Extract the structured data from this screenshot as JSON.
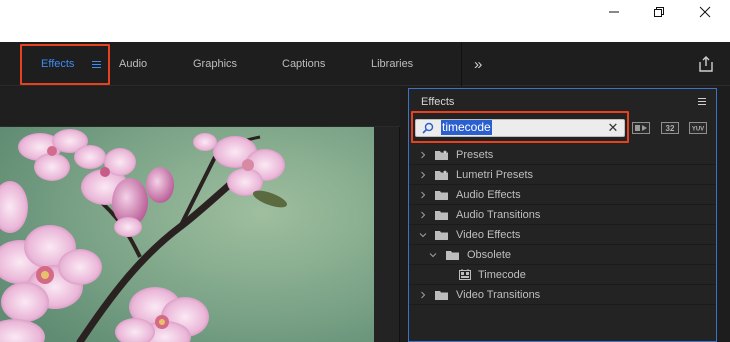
{
  "window": {
    "minimize_icon": "minimize-icon",
    "maximize_icon": "restore-icon",
    "close_icon": "close-icon"
  },
  "workspaces": {
    "tabs": [
      {
        "label": "Effects",
        "active": true
      },
      {
        "label": "Audio"
      },
      {
        "label": "Graphics"
      },
      {
        "label": "Captions"
      },
      {
        "label": "Libraries"
      }
    ],
    "overflow_label": "»",
    "accent": "#3d8bf5",
    "highlight": "#e8411f"
  },
  "effects_panel": {
    "title": "Effects",
    "search": {
      "value": "timecode",
      "clear_label": "✕"
    },
    "buttons": [
      {
        "name": "accelerated-effects-icon"
      },
      {
        "name": "32-bit-color-icon",
        "label": "32"
      },
      {
        "name": "yuv-effects-icon",
        "label": "YUV"
      }
    ],
    "tree": [
      {
        "label": "Presets",
        "type": "folder-star",
        "expanded": false,
        "level": 0
      },
      {
        "label": "Lumetri Presets",
        "type": "folder-star",
        "expanded": false,
        "level": 0
      },
      {
        "label": "Audio Effects",
        "type": "folder",
        "expanded": false,
        "level": 0
      },
      {
        "label": "Audio Transitions",
        "type": "folder",
        "expanded": false,
        "level": 0
      },
      {
        "label": "Video Effects",
        "type": "folder",
        "expanded": true,
        "level": 0
      },
      {
        "label": "Obsolete",
        "type": "folder",
        "expanded": true,
        "level": 1
      },
      {
        "label": "Timecode",
        "type": "effect",
        "level": 2
      },
      {
        "label": "Video Transitions",
        "type": "folder",
        "expanded": false,
        "level": 0
      }
    ]
  }
}
